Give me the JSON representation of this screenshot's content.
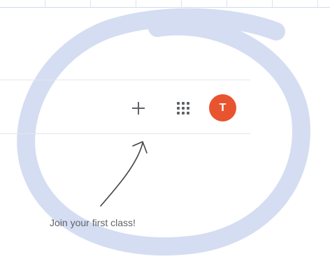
{
  "toolbar": {
    "add_icon": "plus-icon",
    "apps_icon": "apps-grid-icon",
    "avatar_initial": "T"
  },
  "hint": {
    "text": "Join your first class!",
    "arrow_icon": "hand-drawn-arrow-icon"
  },
  "colors": {
    "avatar_bg": "#e8542f",
    "icon_gray": "#5f6368",
    "annotation_circle": "#c7d2ee"
  }
}
